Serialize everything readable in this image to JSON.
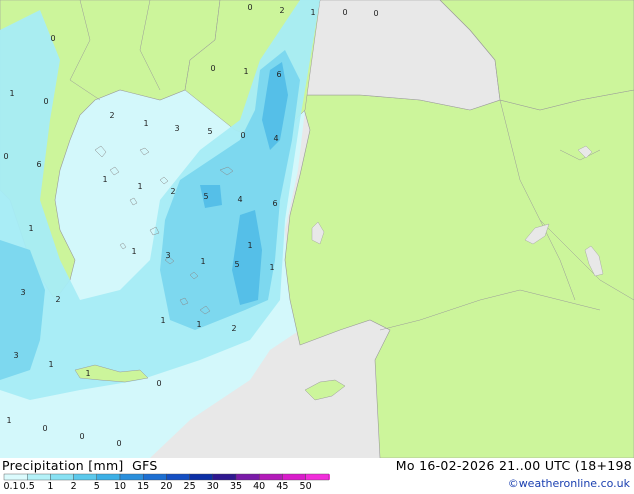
{
  "title": {
    "product": "Precipitation [mm]",
    "model": "GFS",
    "datetime": "Mo 16-02-2026 21..00 UTC (18+198"
  },
  "credit": "©weatheronline.co.uk",
  "colors": {
    "land_green": "#ccf59b",
    "outside_gray": "#e8e8e8",
    "sea_light": "#d3f8fb",
    "precip_light": "#a6ecf5",
    "precip_mid": "#7dd8ef",
    "precip_strong": "#55bfe8",
    "border_gray": "#9a9a9a"
  },
  "legend": {
    "ticks": [
      "0.1",
      "0.5",
      "1",
      "2",
      "5",
      "10",
      "15",
      "20",
      "25",
      "30",
      "35",
      "40",
      "45",
      "50"
    ],
    "colors": [
      "#dcfbfd",
      "#b4f1f8",
      "#88e1f3",
      "#5cc9ec",
      "#3cb0e6",
      "#2a8fdc",
      "#1c6fd2",
      "#144fc3",
      "#0c2fa6",
      "#2f1890",
      "#7a1aa8",
      "#b31ab9",
      "#d91ccb",
      "#f22ddb"
    ]
  },
  "values": [
    {
      "t": "0"
    },
    {
      "t": "2"
    },
    {
      "t": "1"
    },
    {
      "t": "0"
    },
    {
      "t": "0"
    },
    {
      "t": "0"
    },
    {
      "t": "0"
    },
    {
      "t": "1"
    },
    {
      "t": "6"
    },
    {
      "t": "1"
    },
    {
      "t": "0"
    },
    {
      "t": "2"
    },
    {
      "t": "1"
    },
    {
      "t": "3"
    },
    {
      "t": "5"
    },
    {
      "t": "0"
    },
    {
      "t": "4"
    },
    {
      "t": "0"
    },
    {
      "t": "6"
    },
    {
      "t": "1"
    },
    {
      "t": "1"
    },
    {
      "t": "2"
    },
    {
      "t": "5"
    },
    {
      "t": "4"
    },
    {
      "t": "6"
    },
    {
      "t": "1"
    },
    {
      "t": "1"
    },
    {
      "t": "3"
    },
    {
      "t": "1"
    },
    {
      "t": "5"
    },
    {
      "t": "1"
    },
    {
      "t": "1"
    },
    {
      "t": "3"
    },
    {
      "t": "2"
    },
    {
      "t": "1"
    },
    {
      "t": "1"
    },
    {
      "t": "2"
    },
    {
      "t": "3"
    },
    {
      "t": "1"
    },
    {
      "t": "1"
    },
    {
      "t": "0"
    },
    {
      "t": "1"
    },
    {
      "t": "0"
    },
    {
      "t": "0"
    },
    {
      "t": "0"
    }
  ]
}
